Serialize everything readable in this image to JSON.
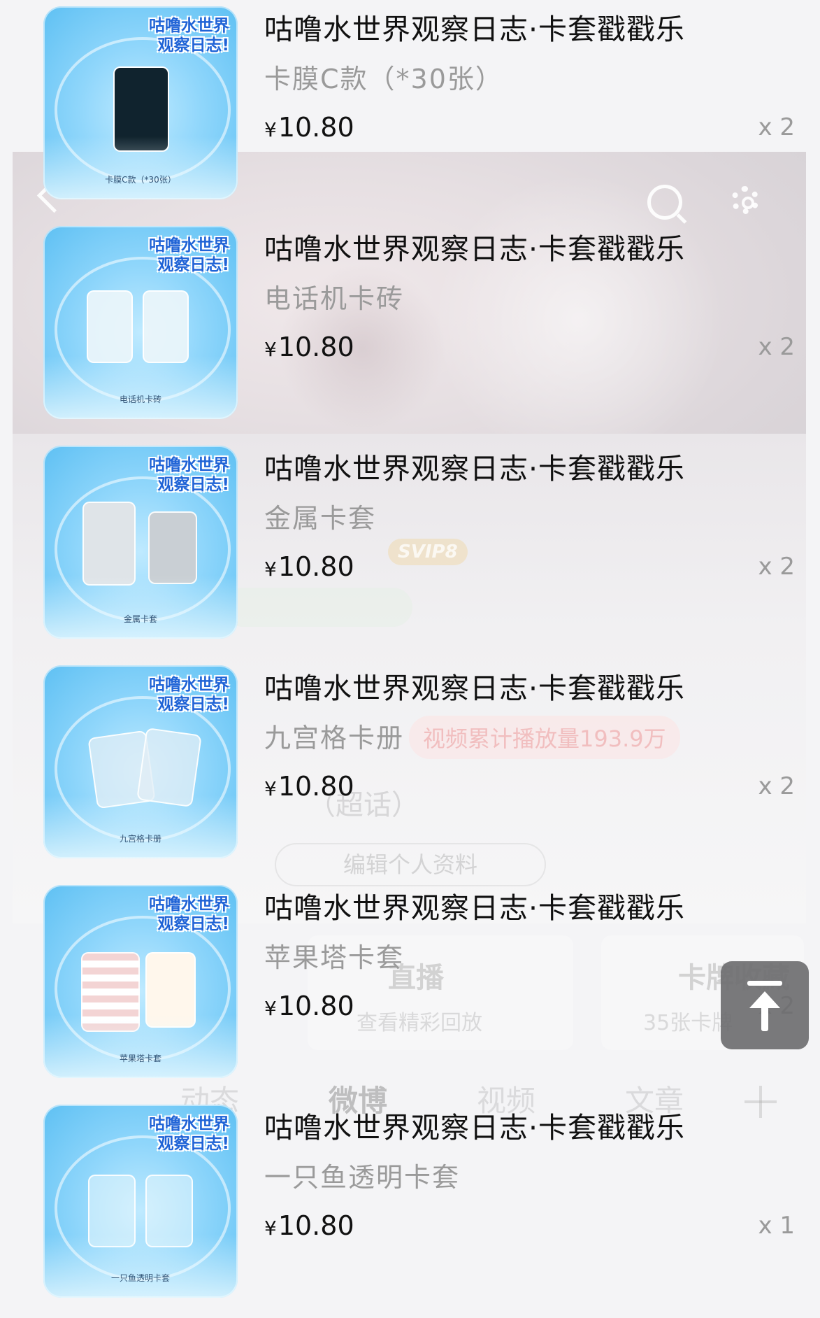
{
  "background_profile": {
    "svip_badge": "SVIP8",
    "views_badge": "视频累计播放量193.9万",
    "super_topic": "（超话）",
    "edit_profile_label": "编辑个人资料",
    "cards": [
      {
        "title": "直播",
        "subtitle": "查看精彩回放"
      },
      {
        "title": "卡牌收藏",
        "subtitle": "35张卡牌"
      }
    ],
    "tabs": [
      "动态",
      "微博",
      "视频",
      "文章"
    ]
  },
  "products": [
    {
      "title": "咕噜水世界观察日志·卡套戳戳乐",
      "variant": "卡膜C款（*30张）",
      "currency": "¥",
      "price": "10.80",
      "quantity": "x 2",
      "thumb_logo": "咕噜水世界观察日志!",
      "thumb_caption": "卡膜C款（*30张）"
    },
    {
      "title": "咕噜水世界观察日志·卡套戳戳乐",
      "variant": "电话机卡砖",
      "currency": "¥",
      "price": "10.80",
      "quantity": "x 2",
      "thumb_logo": "咕噜水世界观察日志!",
      "thumb_caption": "电话机卡砖"
    },
    {
      "title": "咕噜水世界观察日志·卡套戳戳乐",
      "variant": "金属卡套",
      "currency": "¥",
      "price": "10.80",
      "quantity": "x 2",
      "thumb_logo": "咕噜水世界观察日志!",
      "thumb_caption": "金属卡套"
    },
    {
      "title": "咕噜水世界观察日志·卡套戳戳乐",
      "variant": "九宫格卡册",
      "currency": "¥",
      "price": "10.80",
      "quantity": "x 2",
      "thumb_logo": "咕噜水世界观察日志!",
      "thumb_caption": "九宫格卡册"
    },
    {
      "title": "咕噜水世界观察日志·卡套戳戳乐",
      "variant": "苹果塔卡套",
      "currency": "¥",
      "price": "10.80",
      "quantity": "x 2",
      "thumb_logo": "咕噜水世界观察日志!",
      "thumb_caption": "苹果塔卡套"
    },
    {
      "title": "咕噜水世界观察日志·卡套戳戳乐",
      "variant": "一只鱼透明卡套",
      "currency": "¥",
      "price": "10.80",
      "quantity": "x 1",
      "thumb_logo": "咕噜水世界观察日志!",
      "thumb_caption": "一只鱼透明卡套"
    }
  ],
  "icons": {
    "back": "chevron-left-icon",
    "search": "search-icon",
    "settings": "gear-icon",
    "back_to_top": "arrow-up-to-line-icon"
  },
  "colors": {
    "title": "#111111",
    "muted": "#9a9a9a",
    "thumb_blue": "#5ec0f3",
    "logo_blue": "#1f63d6",
    "button_gray": "#6e6e70"
  }
}
